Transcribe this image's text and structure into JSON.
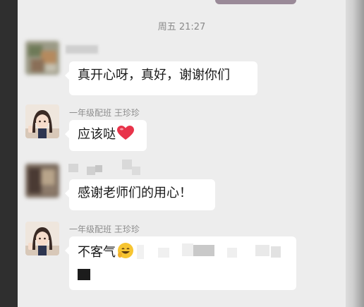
{
  "timestamp": "周五 21:27",
  "colors": {
    "bubble": "#ffffff",
    "background": "#ededed",
    "heart": "#e8334a"
  },
  "messages": [
    {
      "sender_name": "",
      "avatar": "blurred-avatar",
      "text": "真开心呀，真好，谢谢你们"
    },
    {
      "sender_name": "一年级配班  王珍珍",
      "avatar": "girl-avatar",
      "text": "应该哒",
      "emoji": "heart-icon"
    },
    {
      "sender_name": "",
      "avatar": "blurred-avatar",
      "text": "感谢老师们的用心！"
    },
    {
      "sender_name": "一年级配班  王珍珍",
      "avatar": "girl-avatar",
      "text": "不客气",
      "emoji": "smile-icon"
    }
  ]
}
